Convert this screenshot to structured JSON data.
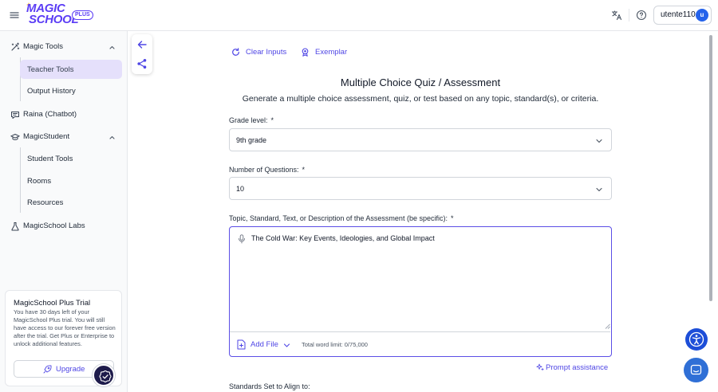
{
  "header": {
    "logo_line1": "MAGIC",
    "logo_line2": "SCHOOL",
    "logo_badge": "PLUS",
    "username": "utente110",
    "avatar_initial": "u"
  },
  "sidebar": {
    "magic_tools": "Magic Tools",
    "teacher_tools": "Teacher Tools",
    "output_history": "Output History",
    "raina": "Raina (Chatbot)",
    "magic_student": "MagicStudent",
    "student_tools": "Student Tools",
    "rooms": "Rooms",
    "resources": "Resources",
    "labs": "MagicSchool Labs",
    "active_item": "Teacher Tools"
  },
  "trial": {
    "title": "MagicSchool Plus Trial",
    "body": "You have 30 days left of your MagicSchool Plus trial. You will still have access to our forever free version after the trial. Get Plus or Enterprise to unlock additional features.",
    "upgrade_label": "Upgrade"
  },
  "actions": {
    "clear_inputs": "Clear Inputs",
    "exemplar": "Exemplar"
  },
  "form": {
    "title": "Multiple Choice Quiz / Assessment",
    "subtitle": "Generate a multiple choice assessment, quiz, or test based on any topic, standard(s), or criteria.",
    "grade_label": "Grade level:",
    "grade_value": "9th grade",
    "questions_label": "Number of Questions:",
    "questions_value": "10",
    "topic_label": "Topic, Standard, Text, or Description of the Assessment (be specific):",
    "topic_value": "The Cold War: Key Events, Ideologies, and Global Impact",
    "add_file": "Add File",
    "word_limit": "Total word limit: 0/75,000",
    "prompt_assistance": "Prompt assistance",
    "standards_label": "Standards Set to Align to:",
    "required_mark": "*"
  },
  "colors": {
    "brand": "#5b3df5",
    "accent": "#4f46e5",
    "active_bg": "#e5e0fb",
    "focus_border": "#5b4ee6"
  }
}
